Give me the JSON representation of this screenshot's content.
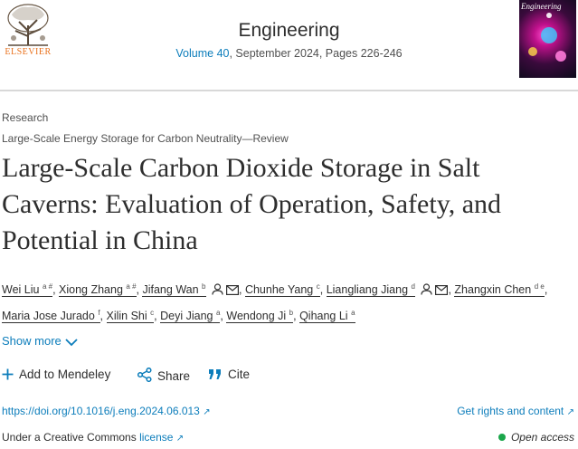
{
  "header": {
    "publisher": "ELSEVIER",
    "journal": "Engineering",
    "volume_link": "Volume 40",
    "issue_info": ", September 2024, Pages 226-246",
    "cover_title": "Engineering"
  },
  "article": {
    "type": "Research",
    "section": "Large-Scale Energy Storage for Carbon Neutrality—Review",
    "title": "Large-Scale Carbon Dioxide Storage in Salt Caverns: Evaluation of Operation, Safety, and Potential in China"
  },
  "authors": [
    {
      "name": "Wei Liu",
      "sup": "a #"
    },
    {
      "name": "Xiong Zhang",
      "sup": "a #"
    },
    {
      "name": "Jifang Wan",
      "sup": "b"
    },
    {
      "name": "Chunhe Yang",
      "sup": "c"
    },
    {
      "name": "Liangliang Jiang",
      "sup": "d"
    },
    {
      "name": "Zhangxin Chen",
      "sup": "d e"
    },
    {
      "name": "Maria Jose Jurado",
      "sup": "f"
    },
    {
      "name": "Xilin Shi",
      "sup": "c"
    },
    {
      "name": "Deyi Jiang",
      "sup": "a"
    },
    {
      "name": "Wendong Ji",
      "sup": "b"
    },
    {
      "name": "Qihang Li",
      "sup": "a"
    }
  ],
  "show_more": "Show more",
  "actions": {
    "add": "Add to Mendeley",
    "share": "Share",
    "cite": "Cite"
  },
  "links": {
    "doi": "https://doi.org/10.1016/j.eng.2024.06.013",
    "rights": "Get rights and content",
    "license_prefix": "Under a Creative Commons ",
    "license": "license",
    "open_access": "Open access"
  },
  "colors": {
    "link": "#0c7dbb",
    "publisher": "#e9711c",
    "open_access_dot": "#1aa64a"
  },
  "icons": [
    "elsevier-tree-logo",
    "journal-cover",
    "person-icon",
    "mail-icon",
    "chevron-down-icon",
    "plus-icon",
    "share-icon",
    "quote-icon",
    "external-link-icon"
  ]
}
